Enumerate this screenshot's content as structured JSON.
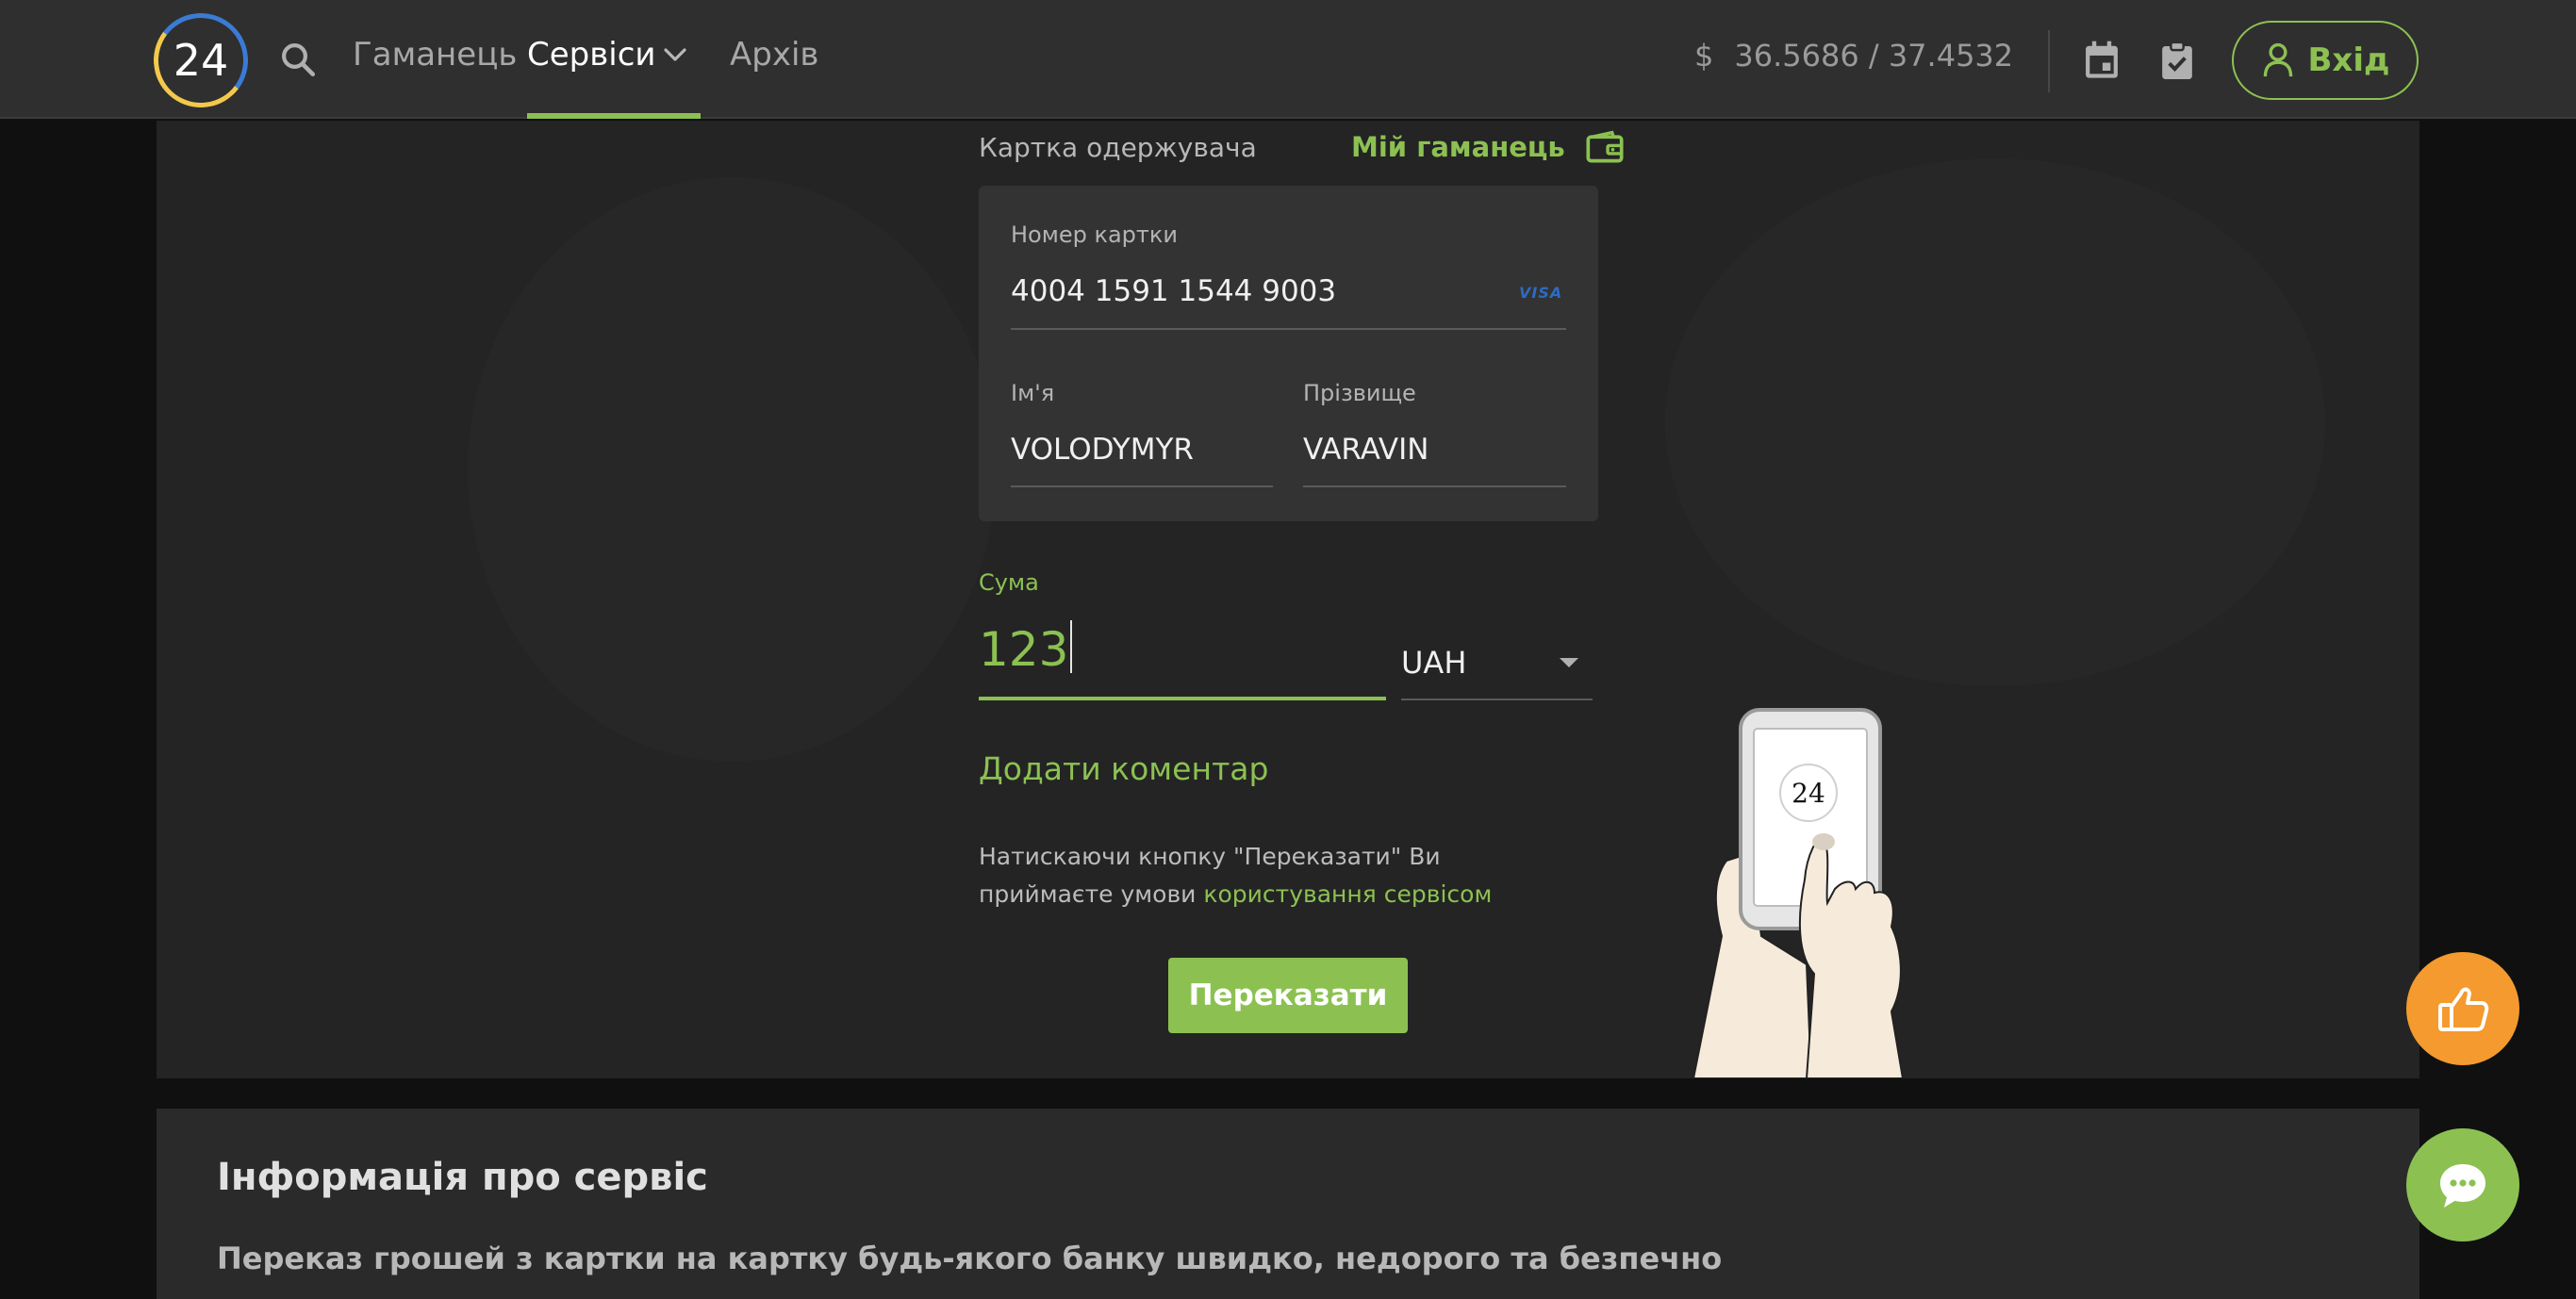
{
  "header": {
    "logo_text": "24",
    "nav": {
      "wallet": "Гаманець",
      "services": "Сервіси",
      "archive": "Архів"
    },
    "rate": {
      "currency_symbol": "$",
      "value": "36.5686 / 37.4532"
    },
    "login_label": "Вхід"
  },
  "form": {
    "recipient_label": "Картка одержувача",
    "my_wallet_link": "Мій гаманець",
    "card_number_label": "Номер картки",
    "card_number_value": "4004 1591 1544 9003",
    "card_brand": "VISA",
    "first_name_label": "Ім'я",
    "first_name_value": "VOLODYMYR",
    "last_name_label": "Прізвище",
    "last_name_value": "VARAVIN",
    "amount_label": "Сума",
    "amount_value": "123",
    "currency_value": "UAH",
    "add_comment": "Додати коментар",
    "terms_text": "Натискаючи кнопку \"Переказати\" Ви приймаєте умови ",
    "terms_link": "користування сервісом",
    "submit_label": "Переказати"
  },
  "illustration": {
    "phone_badge": "24"
  },
  "info": {
    "title": "Інформація про сервіс",
    "subtitle": "Переказ грошей з картки на картку будь-якого банку швидко, недорого та безпечно"
  },
  "colors": {
    "accent": "#8cc152",
    "like_button": "#f49a2f",
    "topbar": "#2f2f2f",
    "panel": "#242424"
  },
  "icons": [
    "search-icon",
    "chevron-down-icon",
    "calendar-icon",
    "clipboard-check-icon",
    "user-icon",
    "wallet-icon",
    "dropdown-arrow-icon",
    "thumbs-up-icon",
    "chat-icon"
  ]
}
